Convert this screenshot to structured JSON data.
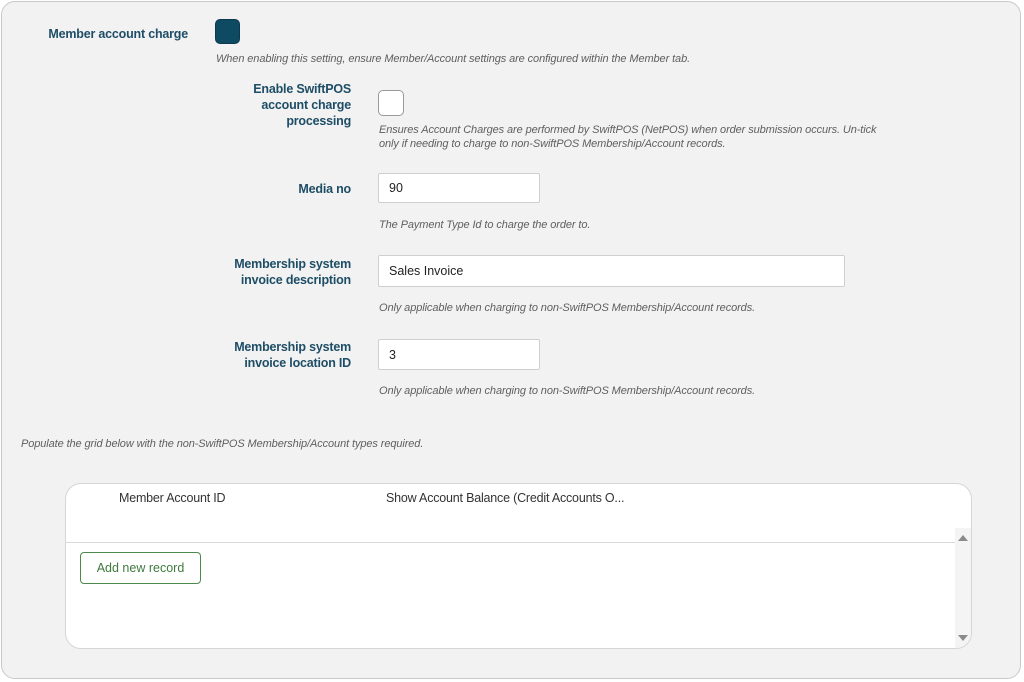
{
  "settings": {
    "member_account_charge": {
      "label": "Member account charge",
      "checked": true,
      "hint": "When enabling this setting, ensure Member/Account settings are configured within the Member tab."
    },
    "enable_swiftpos": {
      "label_lines": [
        "Enable SwiftPOS",
        "account charge",
        "processing"
      ],
      "checked": false,
      "hint_lines": [
        "Ensures Account Charges are performed by SwiftPOS (NetPOS) when order submission occurs. Un-tick",
        "only if needing to charge to non-SwiftPOS Membership/Account records."
      ]
    },
    "media_no": {
      "label": "Media no",
      "value": "90",
      "hint": "The Payment Type Id to charge the order to."
    },
    "invoice_description": {
      "label_lines": [
        "Membership system",
        "invoice description"
      ],
      "value": "Sales Invoice",
      "hint": "Only applicable when charging to non-SwiftPOS Membership/Account records."
    },
    "invoice_location": {
      "label_lines": [
        "Membership system",
        "invoice location ID"
      ],
      "value": "3",
      "hint": "Only applicable when charging to non-SwiftPOS Membership/Account records."
    }
  },
  "grid_intro": "Populate the grid below with the non-SwiftPOS Membership/Account types required.",
  "grid": {
    "columns": [
      "Member Account ID",
      "Show Account Balance (Credit Accounts O..."
    ],
    "rows": [],
    "add_button_label": "Add new record"
  },
  "colors": {
    "label": "#1e4d66",
    "checkbox_on": "#0f4a63",
    "add_button": "#3f7a3f",
    "panel_background": "#f2f2f2"
  },
  "icons": [
    "scroll-up-arrow-icon",
    "scroll-down-arrow-icon"
  ]
}
